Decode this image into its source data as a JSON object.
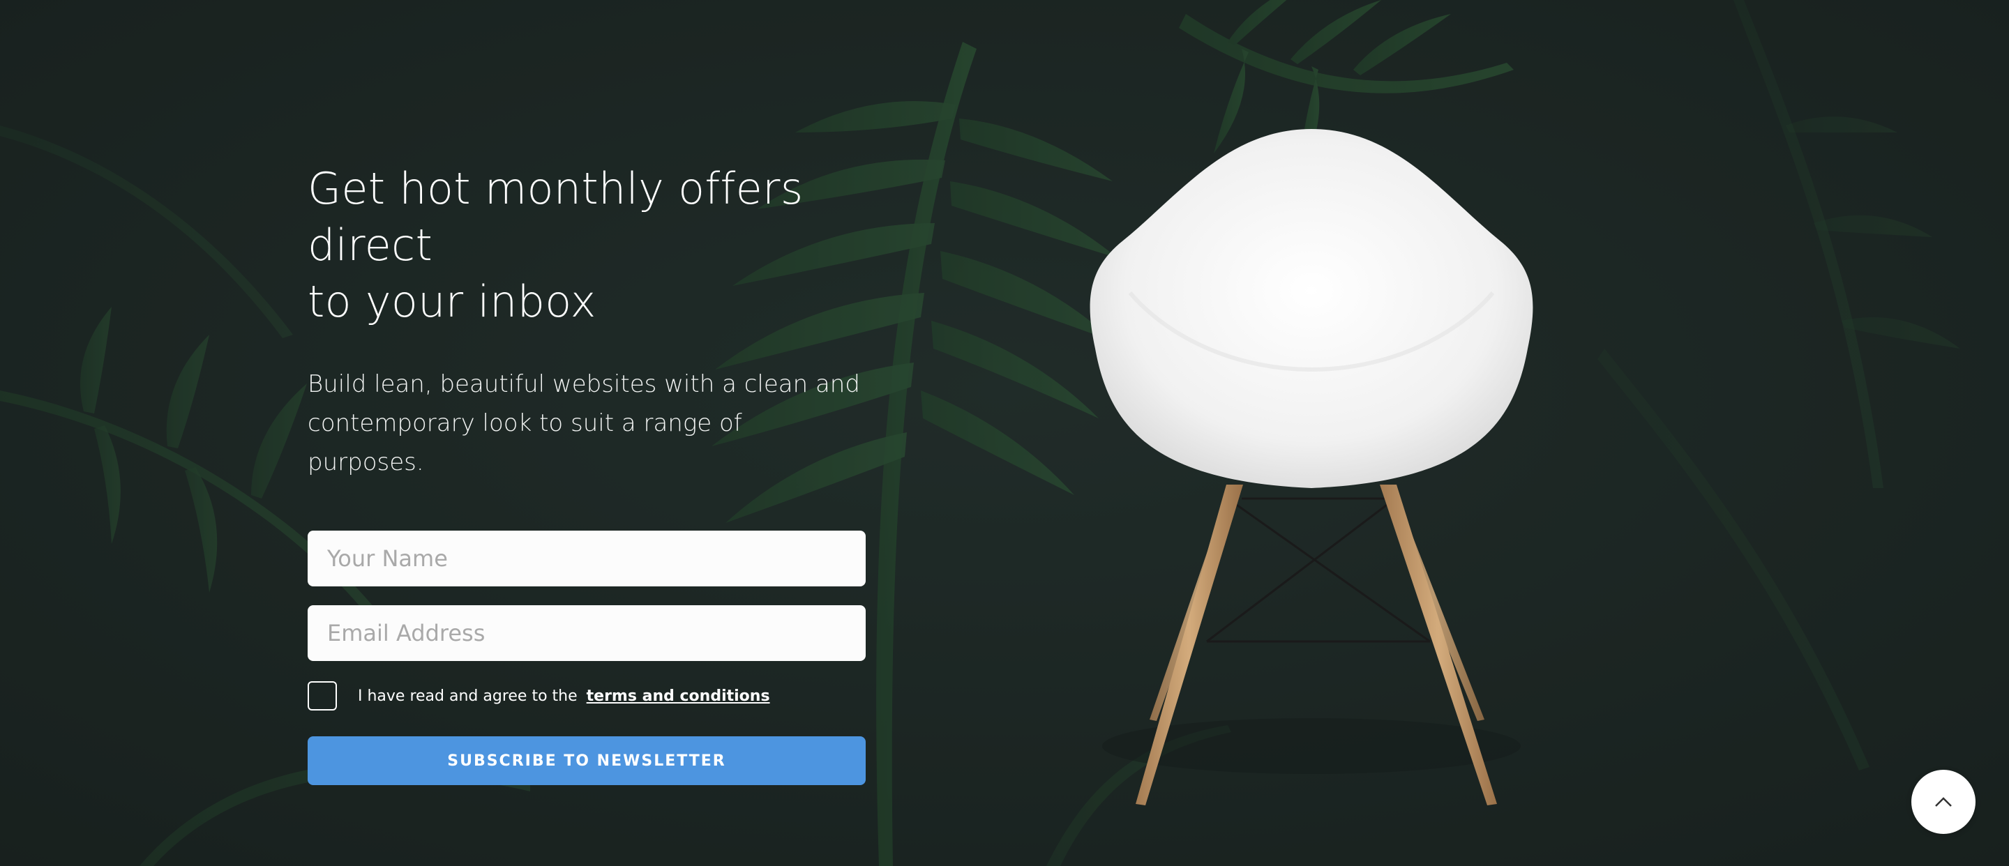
{
  "hero": {
    "title_line1": "Get hot monthly offers direct",
    "title_line2": "to your inbox",
    "lead_line1": "Build lean, beautiful websites with a clean and",
    "lead_line2": "contemporary look to suit a range of purposes."
  },
  "form": {
    "name_placeholder": "Your Name",
    "name_value": "",
    "email_placeholder": "Email Address",
    "email_value": "",
    "agree_text": "I have read and agree to the",
    "terms_link": "terms and conditions",
    "submit_label": "SUBSCRIBE TO NEWSLETTER"
  },
  "icons": {
    "scroll_top": "chevron-up-icon",
    "background": "palm-leaves",
    "product": "white-shell-chair"
  },
  "colors": {
    "background": "#1f2927",
    "leaf": "#2f6a3a",
    "button": "#4d95e0",
    "text": "#ffffff"
  }
}
